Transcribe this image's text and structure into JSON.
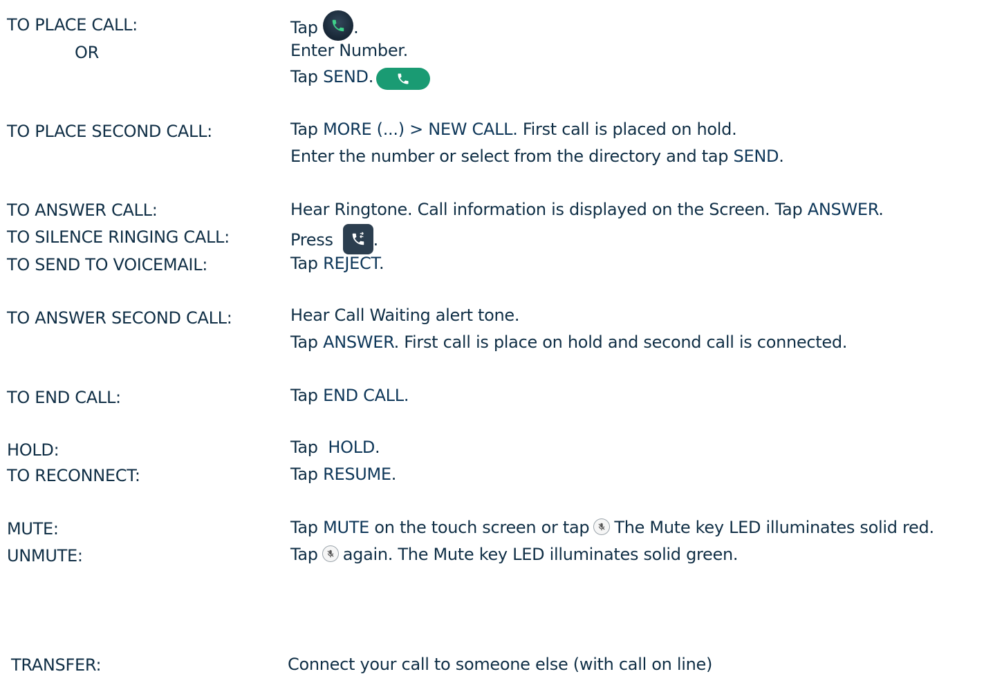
{
  "rows": {
    "place_call": {
      "label": "TO PLACE CALL:",
      "or": "OR",
      "line1_prefix": "Tap",
      "line1_suffix": ".",
      "line2": "Enter Number.",
      "line3_prefix": "Tap",
      "line3_keyword": "SEND",
      "line3_suffix": "."
    },
    "second_call": {
      "label": "TO PLACE SECOND CALL:",
      "line1_prefix": "Tap",
      "line1_keyword": "MORE (...) > NEW CALL.",
      "line1_suffix": "First call is placed on hold.",
      "line2_prefix": "Enter the number or select from the directory and tap",
      "line2_keyword": "SEND",
      "line2_suffix": "."
    },
    "answer_call": {
      "label": "TO ANSWER CALL:",
      "prefix": "Hear Ringtone.  Call information is displayed on the Screen.  Tap",
      "keyword": "ANSWER",
      "suffix": "."
    },
    "silence": {
      "label": "TO SILENCE RINGING CALL:",
      "prefix": "Press",
      "suffix": "."
    },
    "voicemail": {
      "label": "TO SEND TO VOICEMAIL:",
      "prefix": "Tap",
      "keyword": "REJECT",
      "suffix": "."
    },
    "answer_second": {
      "label": "TO ANSWER SECOND CALL:",
      "line1": "Hear Call Waiting alert tone.",
      "line2_prefix": "Tap",
      "line2_keyword": "ANSWER",
      "line2_suffix": ".  First call is place on hold and second call is connected."
    },
    "end_call": {
      "label": "TO END CALL:",
      "prefix": "Tap",
      "keyword": "END CALL."
    },
    "hold": {
      "label": "HOLD:",
      "prefix": "Tap ",
      "keyword": "HOLD",
      "suffix": "."
    },
    "reconnect": {
      "label": "TO RECONNECT:",
      "prefix": "Tap",
      "keyword": "RESUME",
      "suffix": "."
    },
    "mute": {
      "label": "MUTE:",
      "prefix": "Tap",
      "keyword": "MUTE",
      "middle": "on the touch screen or tap",
      "suffix": "The Mute key LED illuminates solid red."
    },
    "unmute": {
      "label": "UNMUTE:",
      "prefix": "Tap",
      "suffix": "again.  The Mute key LED illuminates solid green."
    },
    "transfer": {
      "label": "TRANSFER:",
      "text": "Connect your call to someone else (with call on line)"
    }
  },
  "icons": {
    "call_button": "phone-icon",
    "send_button": "phone-icon",
    "silence_key": "phone-silence-icon",
    "mute_key": "microphone-mute-icon"
  },
  "colors": {
    "text": "#0f2e45",
    "send_green": "#1a9b73",
    "phone_glyph_green": "#3fd08a",
    "dark_key": "#2c3e4f"
  }
}
